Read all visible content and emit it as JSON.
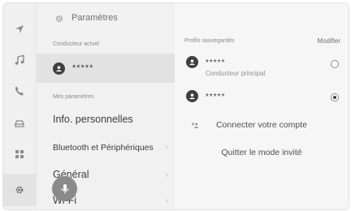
{
  "header": {
    "title": "Paramètres"
  },
  "left": {
    "current_driver_label": "Conducteur actuel",
    "current_driver_name": "*****",
    "my_settings_label": "Mes paramètres",
    "menu": [
      {
        "label": "Info. personnelles"
      },
      {
        "label": "Bluetooth et Périphériques"
      },
      {
        "label": "Général"
      },
      {
        "label": "Wi-Fi"
      }
    ],
    "chevron": "›"
  },
  "right": {
    "saved_profiles_label": "Profils sauvegardés",
    "modify_label": "Modifier",
    "profiles": [
      {
        "name": "*****",
        "subtitle": "Conducteur principal",
        "selected": false
      },
      {
        "name": "*****",
        "subtitle": "",
        "selected": true
      }
    ],
    "connect_account": "Connecter votre compte",
    "quit_guest": "Quitter le mode invité"
  },
  "icons": {
    "rail": [
      "navigation-icon",
      "music-icon",
      "phone-icon",
      "car-icon",
      "apps-grid-icon",
      "settings-gear-icon"
    ],
    "mic": "microphone-icon"
  },
  "colors": {
    "active_row": "#e2e2e2",
    "avatar": "#3f3f3f",
    "mic": "#8a8a8a"
  }
}
